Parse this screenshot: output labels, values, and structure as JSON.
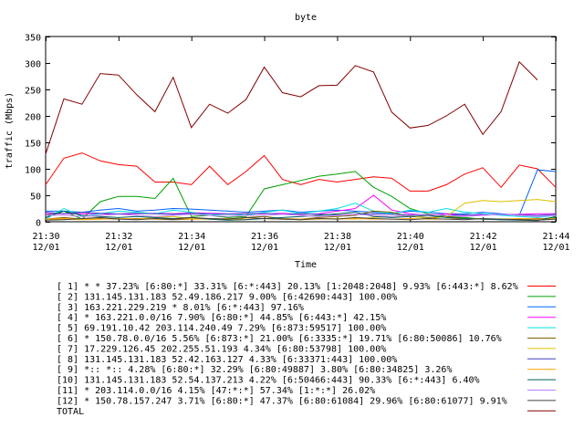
{
  "chart_data": {
    "type": "line",
    "title": "byte",
    "xlabel": "Time",
    "ylabel": "traffic (Mbps)",
    "ylim": [
      0,
      350
    ],
    "yticks": [
      0,
      50,
      100,
      150,
      200,
      250,
      300,
      350
    ],
    "xticks": [
      {
        "time": "21:30",
        "date": "12/01"
      },
      {
        "time": "21:32",
        "date": "12/01"
      },
      {
        "time": "21:34",
        "date": "12/01"
      },
      {
        "time": "21:36",
        "date": "12/01"
      },
      {
        "time": "21:38",
        "date": "12/01"
      },
      {
        "time": "21:40",
        "date": "12/01"
      },
      {
        "time": "21:42",
        "date": "12/01"
      },
      {
        "time": "21:44",
        "date": "12/01"
      }
    ],
    "xlim_minutes": [
      0,
      14
    ],
    "legend_position": "bottom",
    "x": [
      0.0,
      0.5,
      1.0,
      1.5,
      2.0,
      2.5,
      3.0,
      3.5,
      4.0,
      4.5,
      5.0,
      5.5,
      6.0,
      6.5,
      7.0,
      7.5,
      8.0,
      8.5,
      9.0,
      9.5,
      10.0,
      10.5,
      11.0,
      11.5,
      12.0,
      12.5,
      13.0,
      13.5,
      14.0
    ],
    "series": [
      {
        "name": "[ 1] * * 37.23%  [6:80:*] 33.31% [6:*:443] 20.13% [1:2048:2048] 9.93% [6:443:*] 8.62%",
        "color": "#ff0000",
        "values": [
          70,
          120,
          130,
          115,
          108,
          105,
          75,
          75,
          70,
          105,
          70,
          95,
          125,
          80,
          70,
          80,
          75,
          80,
          85,
          82,
          58,
          58,
          70,
          90,
          102,
          65,
          107,
          100,
          65
        ]
      },
      {
        "name": "[ 2] 131.145.131.183 52.49.186.217 9.00%  [6:42690:443] 100.00%",
        "color": "#00a000",
        "values": [
          12,
          20,
          5,
          38,
          48,
          48,
          44,
          82,
          10,
          12,
          8,
          10,
          62,
          70,
          78,
          86,
          90,
          95,
          65,
          48,
          25,
          15,
          10,
          8,
          5,
          5,
          5,
          5,
          8
        ]
      },
      {
        "name": "[ 3] 163.221.229.219 * 8.01%  [6:*:443] 97.16%",
        "color": "#0060ff",
        "values": [
          20,
          20,
          18,
          22,
          25,
          20,
          22,
          25,
          24,
          22,
          20,
          18,
          20,
          22,
          18,
          20,
          22,
          20,
          18,
          16,
          20,
          18,
          15,
          15,
          18,
          15,
          12,
          98,
          95
        ]
      },
      {
        "name": "[ 4] * 163.221.0.0/16 7.90%  [6:80:*] 44.85% [6:443:*] 42.15%",
        "color": "#ff00ff",
        "values": [
          15,
          15,
          15,
          15,
          14,
          15,
          16,
          15,
          17,
          16,
          15,
          15,
          15,
          16,
          14,
          15,
          20,
          25,
          50,
          22,
          15,
          12,
          15,
          12,
          14,
          13,
          14,
          15,
          15
        ]
      },
      {
        "name": "[ 5] 69.191.10.42 203.114.240.49 7.29%  [6:873:59517] 100.00%",
        "color": "#00e0e0",
        "values": [
          5,
          25,
          10,
          15,
          20,
          18,
          15,
          22,
          18,
          12,
          15,
          12,
          18,
          22,
          15,
          20,
          25,
          35,
          20,
          15,
          22,
          18,
          25,
          18,
          15,
          12,
          10,
          8,
          12
        ]
      },
      {
        "name": "[ 6] * 150.78.0.0/16 5.56%  [6:873:*] 21.00% [6:3335:*] 19.71% [6:80:50086] 10.76%",
        "color": "#806000",
        "values": [
          5,
          8,
          5,
          6,
          5,
          6,
          5,
          4,
          5,
          6,
          5,
          8,
          10,
          6,
          5,
          8,
          10,
          12,
          20,
          18,
          10,
          8,
          10,
          6,
          5,
          4,
          5,
          6,
          5
        ]
      },
      {
        "name": "[ 7] 17.229.126.45 202.255.51.193 4.34%  [6:80:53798] 100.00%",
        "color": "#e0c000",
        "values": [
          5,
          5,
          4,
          5,
          6,
          5,
          8,
          10,
          6,
          5,
          4,
          5,
          6,
          5,
          4,
          5,
          6,
          5,
          8,
          10,
          12,
          5,
          10,
          35,
          40,
          38,
          40,
          42,
          38
        ]
      },
      {
        "name": "[ 8] 131.145.131.183 52.42.163.127 4.33%  [6:33371:443] 100.00%",
        "color": "#4040c0",
        "values": [
          18,
          15,
          18,
          16,
          15,
          16,
          15,
          14,
          16,
          15,
          14,
          15,
          16,
          14,
          15,
          14,
          13,
          14,
          15,
          14,
          13,
          14,
          12,
          13,
          12,
          14,
          13,
          12,
          14
        ]
      },
      {
        "name": "[ 9] *:: *:: 4.28%  [6:80:*] 32.29% [6:80:49887] 3.80% [6:80:34825] 3.26%",
        "color": "#ffa000",
        "values": [
          5,
          6,
          5,
          5,
          6,
          5,
          5,
          6,
          5,
          5,
          6,
          5,
          6,
          5,
          5,
          6,
          5,
          6,
          5,
          5,
          6,
          5,
          5,
          6,
          5,
          5,
          6,
          5,
          6
        ]
      },
      {
        "name": "[10] 131.145.131.183 52.54.137.213 4.22%  [6:50466:443] 90.33% [6:*:443] 6.40%",
        "color": "#006060",
        "values": [
          8,
          20,
          12,
          10,
          8,
          10,
          8,
          6,
          8,
          5,
          3,
          4,
          6,
          8,
          10,
          12,
          15,
          18,
          10,
          8,
          10,
          12,
          8,
          6,
          5,
          4,
          3,
          2,
          10
        ]
      },
      {
        "name": "[11] * 203.114.0.0/16 4.15%  [47:*:*] 57.34% [1:*:*] 26.02%",
        "color": "#c080ff",
        "values": [
          12,
          12,
          10,
          12,
          14,
          12,
          10,
          12,
          14,
          12,
          10,
          12,
          12,
          14,
          12,
          10,
          12,
          14,
          12,
          10,
          12,
          14,
          12,
          10,
          12,
          14,
          12,
          10,
          12
        ]
      },
      {
        "name": "[12] * 150.78.157.247 3.71%  [6:80:*] 47.37% [6:80:61084] 29.96% [6:80:61077] 9.91%",
        "color": "#404040",
        "values": [
          3,
          4,
          6,
          8,
          5,
          4,
          6,
          5,
          8,
          6,
          5,
          8,
          6,
          5,
          4,
          6,
          5,
          8,
          6,
          5,
          4,
          6,
          5,
          4,
          6,
          5,
          4,
          3,
          5
        ]
      },
      {
        "name": "TOTAL",
        "color": "#800000",
        "values": [
          128,
          232,
          222,
          280,
          277,
          240,
          208,
          273,
          178,
          222,
          205,
          231,
          292,
          244,
          236,
          257,
          258,
          295,
          283,
          207,
          177,
          182,
          200,
          222,
          165,
          208,
          302,
          268,
          null
        ]
      }
    ]
  }
}
